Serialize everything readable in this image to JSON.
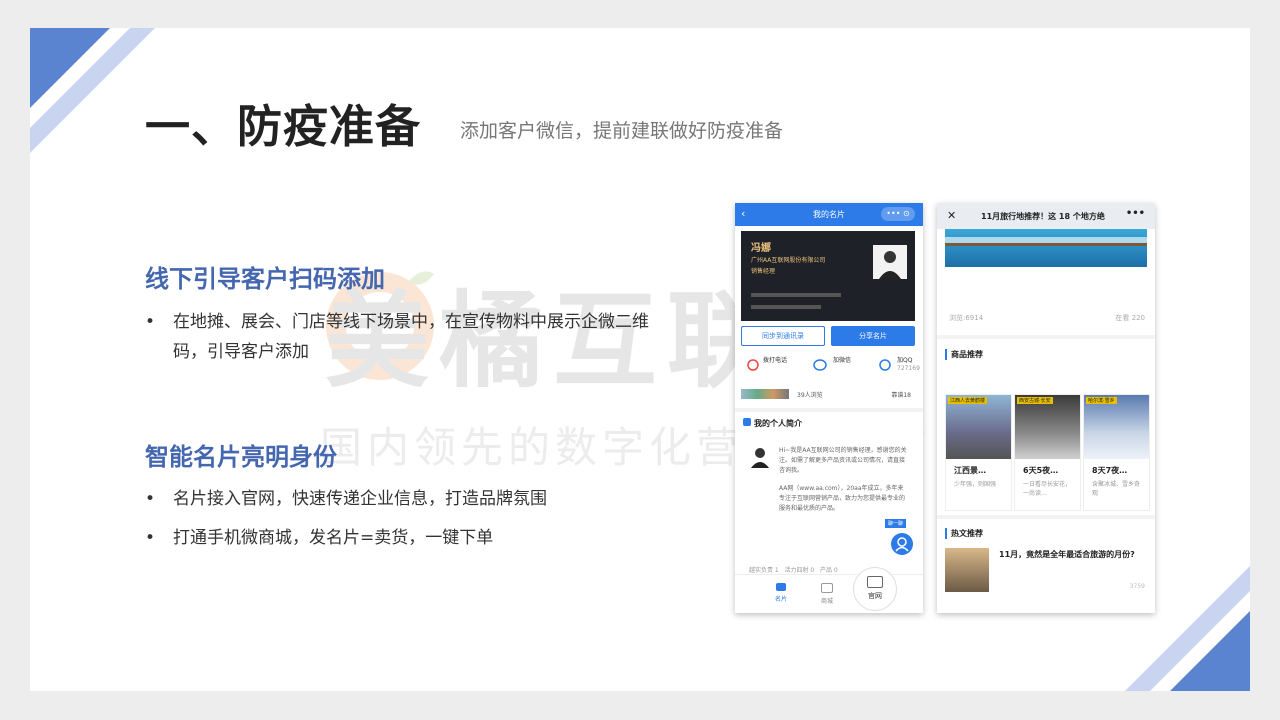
{
  "slide": {
    "title": "一、防疫准备",
    "subtitle": "添加客户微信，提前建联做好防疫准备",
    "watermark_brand": "美橘互联",
    "watermark_slogan": "国内领先的数字化营销服务商",
    "section1": {
      "heading": "线下引导客户扫码添加",
      "bullets": [
        "在地摊、展会、门店等线下场景中，在宣传物料中展示企微二维码，引导客户添加"
      ]
    },
    "section2": {
      "heading": "智能名片亮明身份",
      "bullets": [
        "名片接入官网，快速传递企业信息，打造品牌氛围",
        "打通手机微商城，发名片=卖货，一键下单"
      ]
    },
    "bullet_char": "•",
    "colors": {
      "accent": "#4467b0",
      "deco_blue": "#5b84d0",
      "deco_light": "#c8d4f0",
      "phone_blue": "#2d7be8"
    }
  },
  "phone1": {
    "nav_title": "我的名片",
    "back_icon": "‹",
    "capsule": "••• ⊙",
    "card_name": "冯娜",
    "card_company": "广州AA互联网股份有限公司",
    "card_role": "销售经理",
    "btn_sync": "同步到通讯录",
    "btn_share": "分享名片",
    "contact_phone": "拨打电话",
    "contact_wechat": "加微信",
    "contact_qq": "加QQ",
    "qq_number": "727169",
    "visitors": "39人浏览",
    "likes": "靠谱18",
    "intro_title": "我的个人简介",
    "intro_text": "Hi~我是AA互联网公司的销售经理，感谢您的关注。如需了解更多产品资讯或公司情况，请直接咨询我。",
    "intro_text2": "AA网（www.aa.com），20aa年成立，多年来专注于互联网营销产品，致力为您提供最专业的服务和最优质的产品。",
    "tags": [
      "越实负责 1",
      "活力四射 0",
      "产品 0"
    ],
    "chat_label": "聊一聊",
    "tab_card": "名片",
    "tab_mall": "商城",
    "tab_site": "官网"
  },
  "phone2": {
    "close_icon": "✕",
    "title": "11月旅行地推荐！这 18 个地方绝",
    "more_icon": "•••",
    "views": "浏览:6914",
    "watching": "在看 220",
    "section_products": "商品推荐",
    "products": [
      {
        "badge": "江西人去黄鹤楼",
        "title": "江西景…",
        "desc": "少年强，则国强"
      },
      {
        "badge": "西安古城·长安",
        "title": "6天5夜…",
        "desc": "一日看尽长安花，一尚读…"
      },
      {
        "badge": "哈尔滨·雪乡",
        "title": "8天7夜…",
        "desc": "含聚冰城、雪乡奇观"
      }
    ],
    "section_articles": "热文推荐",
    "article_title": "11月，竟然是全年最适合旅游的月份?",
    "article_views": "3759"
  }
}
